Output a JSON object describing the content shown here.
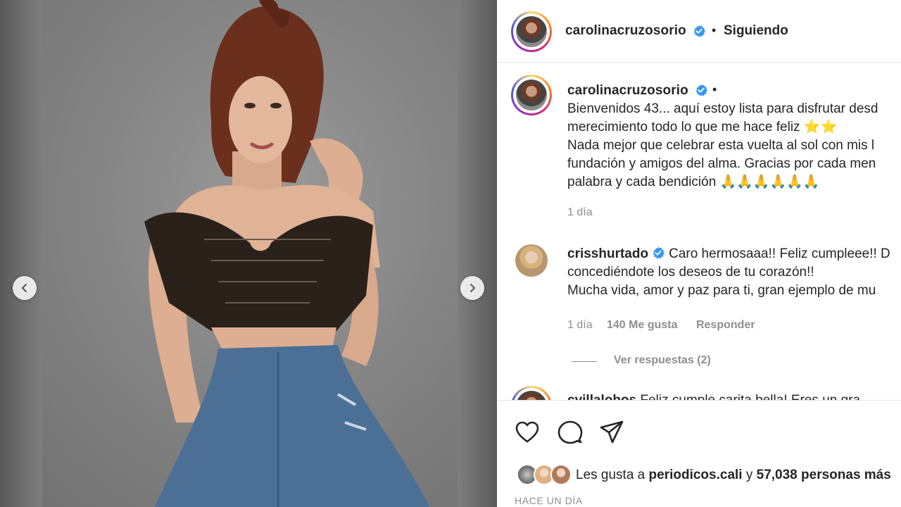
{
  "post": {
    "username": "carolinacruzosorio",
    "follow_separator": "•",
    "follow_status": "Siguiendo"
  },
  "caption": {
    "username": "carolinacruzosorio",
    "separator": "•",
    "lines": [
      "Bienvenidos 43... aquí estoy lista para disfrutar desd",
      "merecimiento todo lo que me hace feliz ⭐⭐",
      "Nada mejor que celebrar esta vuelta al sol con mis l",
      "fundación y amigos del alma. Gracias por cada men",
      "palabra y cada bendición 🙏🙏🙏🙏🙏🙏"
    ],
    "time": "1 día"
  },
  "comments": [
    {
      "username": "crisshurtado",
      "lines": [
        "Caro hermosaaa!! Feliz cumpleee!! D",
        "concediéndote los deseos de tu corazón!!",
        "Mucha vida, amor y paz para ti, gran ejemplo de mu"
      ],
      "time": "1 día",
      "likes": "140 Me gusta",
      "reply": "Responder",
      "view_replies": "Ver respuestas (2)"
    },
    {
      "username": "cvillalobos",
      "text_partial": "Feliz cumple carita bella! Eres un gra"
    }
  ],
  "likes": {
    "prefix": "Les gusta a",
    "user": "periodicos.cali",
    "joiner": "y",
    "count": "57,038 personas más"
  },
  "time_ago": "HACE UN DÍA",
  "icons": [
    "heart-icon",
    "comment-icon",
    "share-icon",
    "chevron-left-icon",
    "chevron-right-icon",
    "verified-icon"
  ],
  "colors": {
    "verified": "#3897f0",
    "text": "#262626",
    "muted": "#8e8e8e",
    "divider": "#e6e6e6"
  }
}
